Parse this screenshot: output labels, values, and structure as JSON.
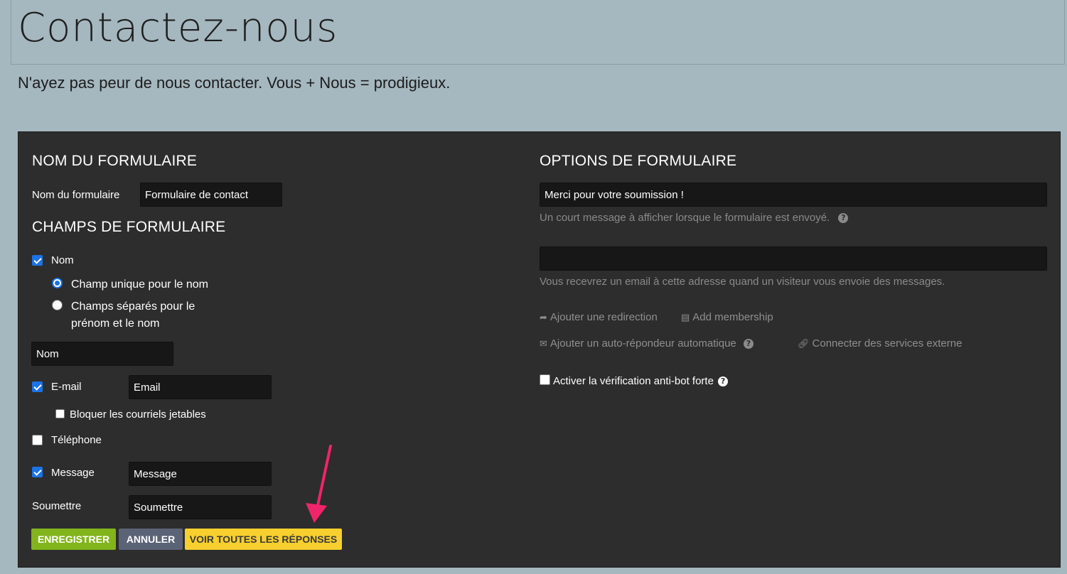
{
  "header": {
    "title": "Contactez-nous",
    "tagline": "N'ayez pas peur de nous contacter. Vous + Nous = prodigieux."
  },
  "form_name": {
    "section_title": "NOM DU FORMULAIRE",
    "label": "Nom du formulaire",
    "value": "Formulaire de contact"
  },
  "fields": {
    "section_title": "CHAMPS DE FORMULAIRE",
    "name": {
      "label": "Nom",
      "checked": true,
      "option_single": "Champ unique pour le nom",
      "option_split": "Champs séparés pour le prénom et le nom",
      "value": "Nom"
    },
    "email": {
      "label": "E-mail",
      "checked": true,
      "value": "Email",
      "block_disposable": "Bloquer les courriels jetables"
    },
    "phone": {
      "label": "Téléphone",
      "checked": false
    },
    "message": {
      "label": "Message",
      "checked": true,
      "value": "Message"
    },
    "submit": {
      "label": "Soumettre",
      "value": "Soumettre"
    }
  },
  "options": {
    "section_title": "OPTIONS DE FORMULAIRE",
    "success_message": "Merci pour votre soumission !",
    "success_help": "Un court message à afficher lorsque le formulaire est envoyé.",
    "email_value": "",
    "email_help": "Vous recevrez un email à cette adresse quand un visiteur vous envoie des messages.",
    "add_redirect": "Ajouter une redirection",
    "add_membership": "Add membership",
    "add_autoresponder": "Ajouter un auto-répondeur automatique",
    "connect_services": "Connecter des services externe",
    "antibot_label": "Activer la vérification anti-bot forte"
  },
  "buttons": {
    "save": "ENREGISTRER",
    "cancel": "ANNULER",
    "view_responses": "VOIR TOUTES LES RÉPONSES"
  },
  "colors": {
    "page_bg": "#a5b7bf",
    "panel_bg": "#2d2d2d",
    "save": "#82b41c",
    "cancel": "#5b6377",
    "view": "#f7cf2e",
    "annotation_arrow": "#f0246a"
  },
  "icons": {
    "help": "question-circle-icon",
    "redirect": "share-arrow-icon",
    "membership": "id-card-icon",
    "autoresponder": "envelope-icon",
    "connect": "link-icon",
    "annotation": "pointer-arrow-icon"
  }
}
